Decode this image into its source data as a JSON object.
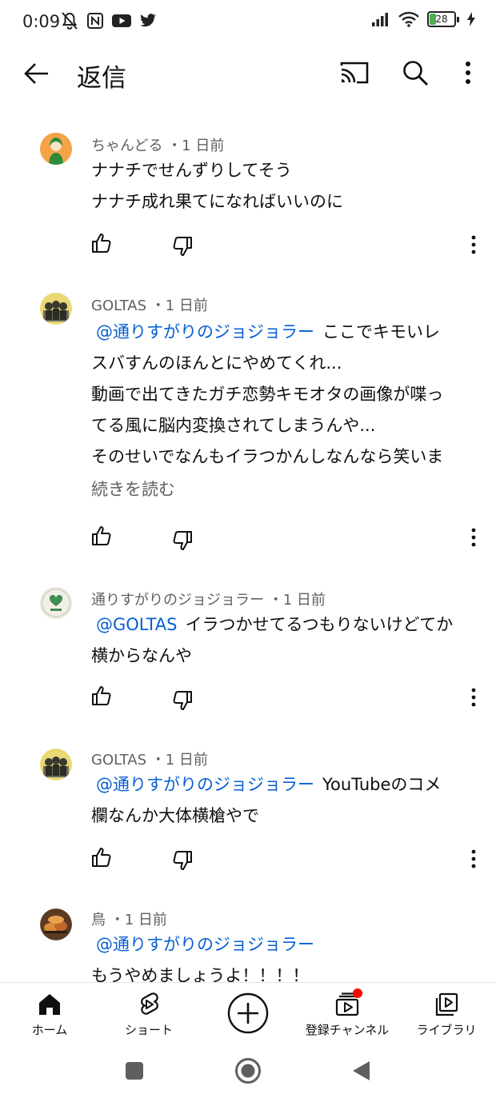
{
  "status_bar": {
    "time": "0:09",
    "battery": "28"
  },
  "header": {
    "title": "返信"
  },
  "comments": [
    {
      "author": "ちゃんどる",
      "age": "1 日前",
      "meta": "ちゃんどる ・1 日前",
      "mention": "",
      "lines": [
        "ナナチでせんずりしてそう",
        "ナナチ成れ果てになればいいのに"
      ]
    },
    {
      "author": "GOLTAS",
      "age": "1 日前",
      "meta": "GOLTAS ・1 日前",
      "mention": "@通りすがりのジョジョラー",
      "first_line_rest": "ここでキモいレ",
      "lines": [
        "スバすんのほんとにやめてくれ...",
        "動画で出てきたガチ恋勢キモオタの画像が喋っ",
        "てる風に脳内変換されてしまうんや...",
        "そのせいでなんもイラつかんしなんなら笑いま"
      ],
      "read_more": "続きを読む"
    },
    {
      "author": "通りすがりのジョジョラー",
      "age": "1 日前",
      "meta": "通りすがりのジョジョラー ・1 日前",
      "mention": "@GOLTAS",
      "first_line_rest": "イラつかせてるつもりないけどてか",
      "lines": [
        "横からなんや"
      ]
    },
    {
      "author": "GOLTAS",
      "age": "1 日前",
      "meta": "GOLTAS ・1 日前",
      "mention": "@通りすがりのジョジョラー",
      "first_line_rest": "YouTubeのコメ",
      "lines": [
        "欄なんか大体横槍やで"
      ]
    },
    {
      "author": "鳥",
      "age": "1 日前",
      "meta": "鳥 ・1 日前",
      "mention": "@通りすがりのジョジョラー",
      "first_line_rest": "",
      "lines": [
        "もうやめましょうよ！！！！"
      ]
    }
  ],
  "bottom_nav": {
    "home": "ホーム",
    "shorts": "ショート",
    "subscriptions": "登録チャンネル",
    "library": "ライブラリ"
  },
  "colors": {
    "mention": "#065fd4",
    "meta": "#606060",
    "text": "#0f0f0f",
    "badge": "#ff0000"
  }
}
